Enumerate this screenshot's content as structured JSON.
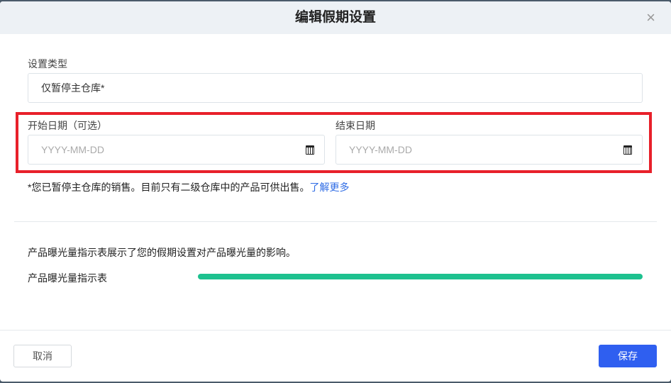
{
  "dialog": {
    "title": "编辑假期设置",
    "close_icon": "×"
  },
  "type_field": {
    "label": "设置类型",
    "value": "仅暂停主仓库*"
  },
  "start_date": {
    "label": "开始日期（可选）",
    "placeholder": "YYYY-MM-DD"
  },
  "end_date": {
    "label": "结束日期",
    "placeholder": "YYYY-MM-DD"
  },
  "note": {
    "text": "*您已暂停主仓库的销售。目前只有二级仓库中的产品可供出售。",
    "link": "了解更多"
  },
  "exposure": {
    "description": "产品曝光量指示表展示了您的假期设置对产品曝光量的影响。",
    "label": "产品曝光量指示表",
    "level_percent": 100,
    "color": "#1dc18f"
  },
  "footer": {
    "cancel": "取消",
    "save": "保存"
  }
}
